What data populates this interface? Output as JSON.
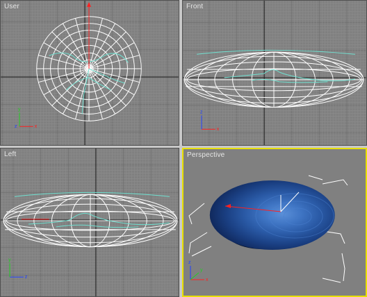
{
  "viewports": {
    "user": {
      "label": "User"
    },
    "front": {
      "label": "Front"
    },
    "left": {
      "label": "Left"
    },
    "perspective": {
      "label": "Perspective",
      "active": true
    }
  },
  "axis_labels": {
    "x": "x",
    "y": "y",
    "z": "z"
  },
  "colors": {
    "viewport_bg": "#808080",
    "grid_minor": "#8c8c8c",
    "grid_major": "#6e6e6e",
    "home_grid": "#1a1a1a",
    "wire": "#ffffff",
    "wire_cyan": "#6fe0d0",
    "active_border": "#e8e000",
    "axis_x": "#ff2020",
    "axis_y": "#20d020",
    "axis_z": "#2040ff"
  }
}
